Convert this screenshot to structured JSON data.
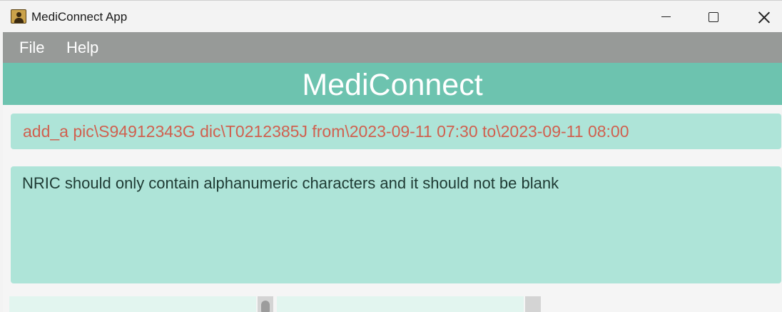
{
  "window": {
    "title": "MediConnect App",
    "icon": "address-book-icon"
  },
  "menu": {
    "file_label": "File",
    "help_label": "Help"
  },
  "header": {
    "title": "MediConnect"
  },
  "command": {
    "value": "add_a pic\\S94912343G dic\\T0212385J from\\2023-09-11 07:30 to\\2023-09-11 08:00"
  },
  "result": {
    "message": "NRIC should only contain alphanumeric characters and it should not be blank"
  },
  "colors": {
    "header_bg": "#6dc3af",
    "menubar_bg": "#979a98",
    "panel_bg": "#aee4d8",
    "error_text": "#d0604f",
    "result_text": "#1e3a33"
  }
}
